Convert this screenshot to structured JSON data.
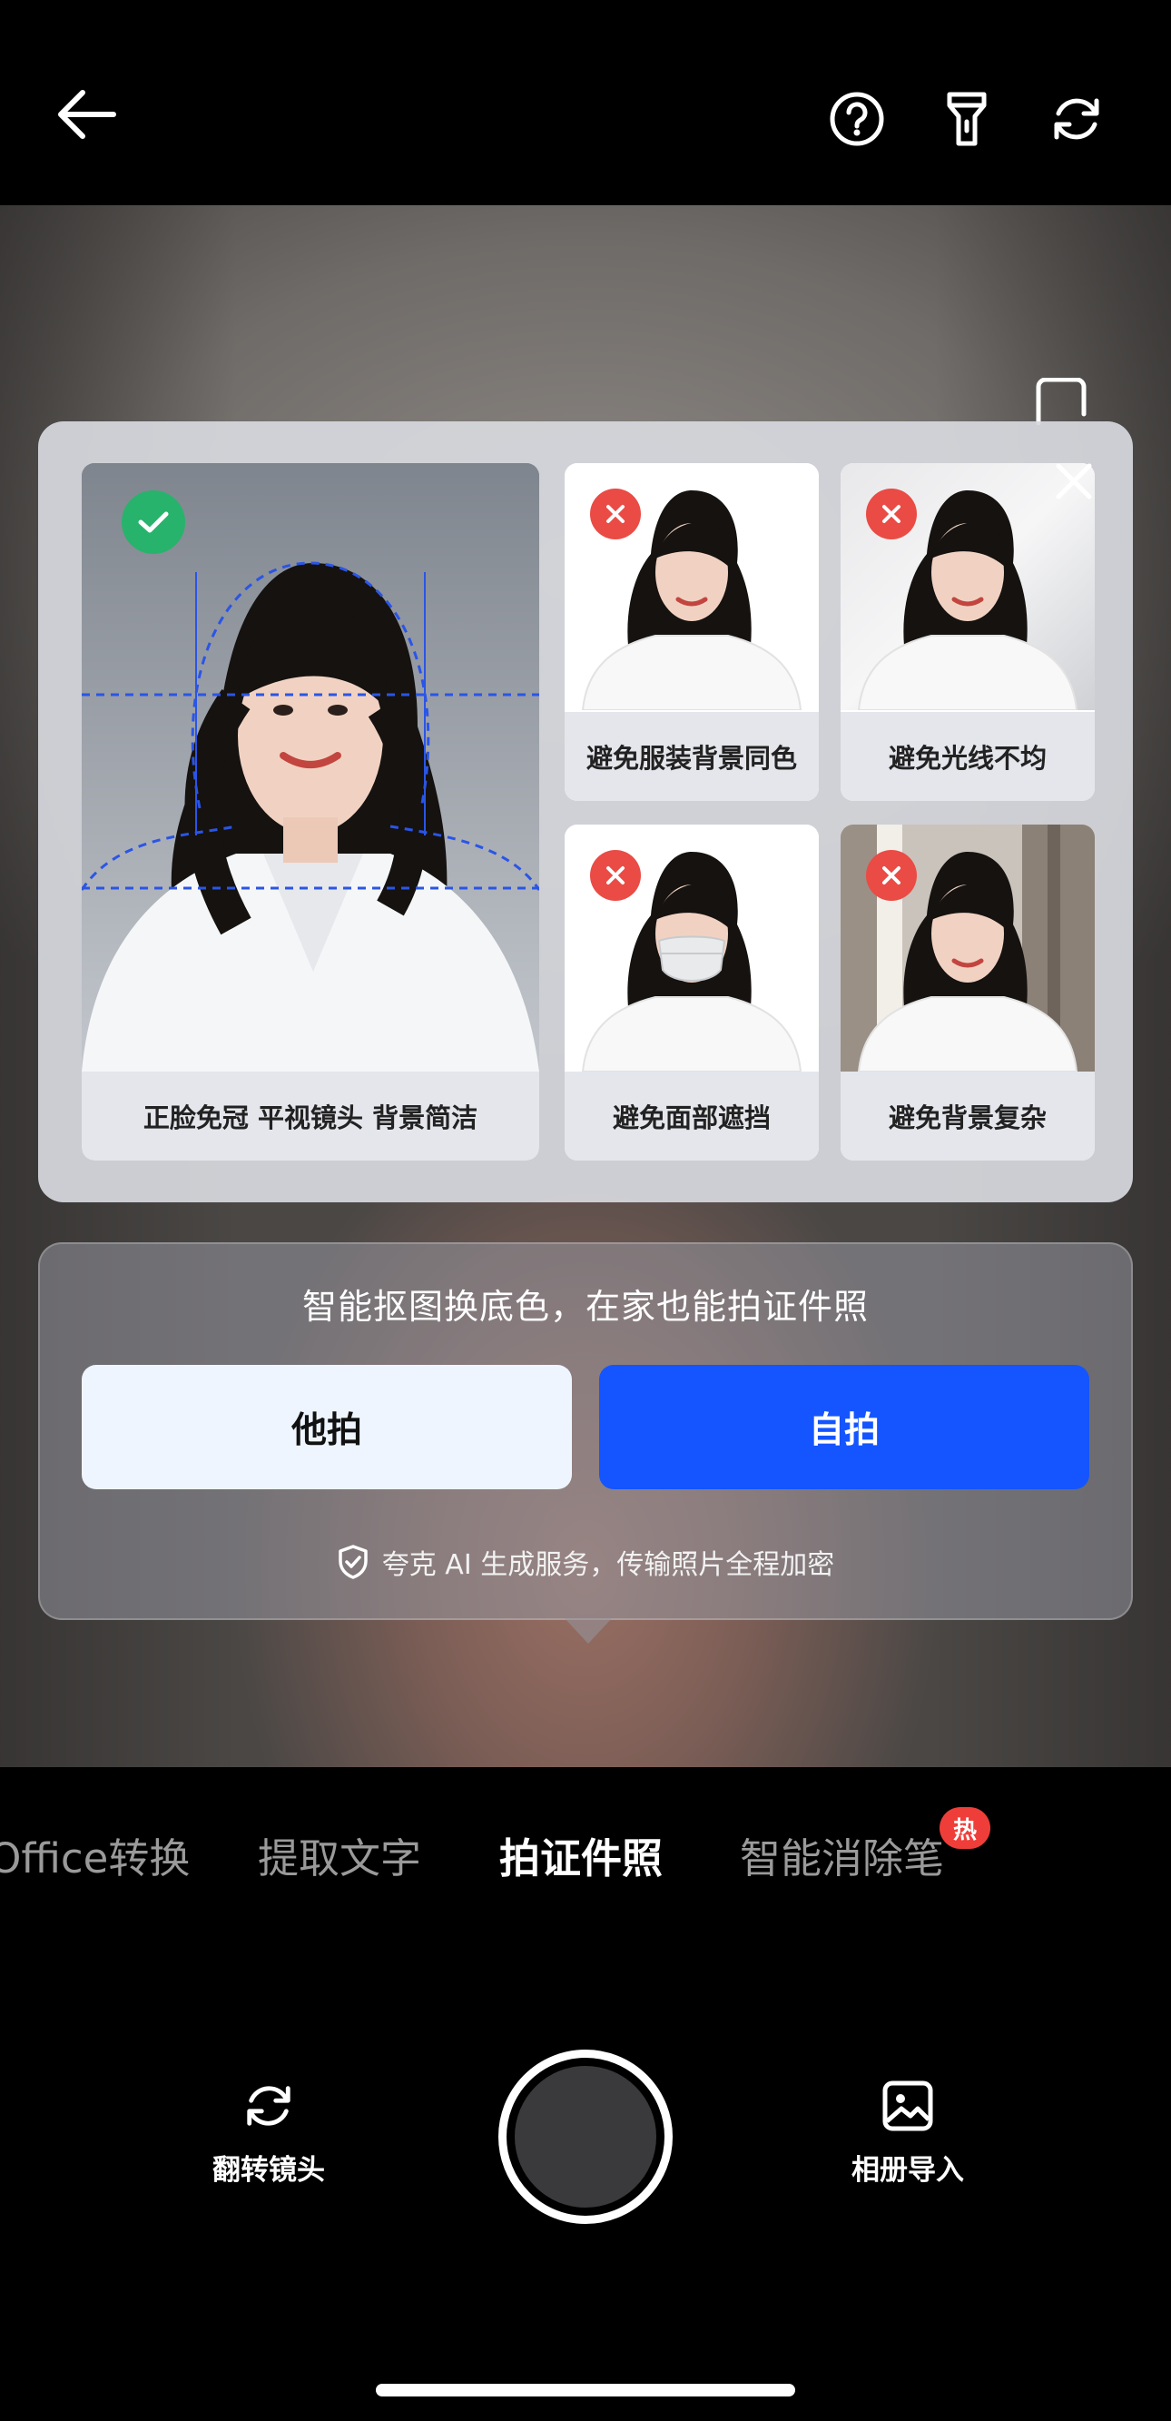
{
  "guide": {
    "good_caption": "正脸免冠 平视镜头 背景简洁",
    "bad_items": [
      {
        "label": "避免服装背景同色"
      },
      {
        "label": "避免光线不均"
      },
      {
        "label": "避免面部遮挡"
      },
      {
        "label": "避免背景复杂"
      }
    ]
  },
  "action": {
    "tagline": "智能抠图换底色，在家也能拍证件照",
    "other_label": "他拍",
    "self_label": "自拍",
    "secure_text": "夸克 AI 生成服务，传输照片全程加密"
  },
  "modes": [
    {
      "label": "Office转换"
    },
    {
      "label": "提取文字"
    },
    {
      "label": "拍证件照"
    },
    {
      "label": "智能消除笔"
    }
  ],
  "hot_badge": "热",
  "controls": {
    "flip_label": "翻转镜头",
    "album_label": "相册导入"
  },
  "colors": {
    "primary_blue": "#1455ff",
    "ok_green": "#27b36b",
    "bad_red": "#ea4b45",
    "guide_line": "#2a55e6"
  }
}
